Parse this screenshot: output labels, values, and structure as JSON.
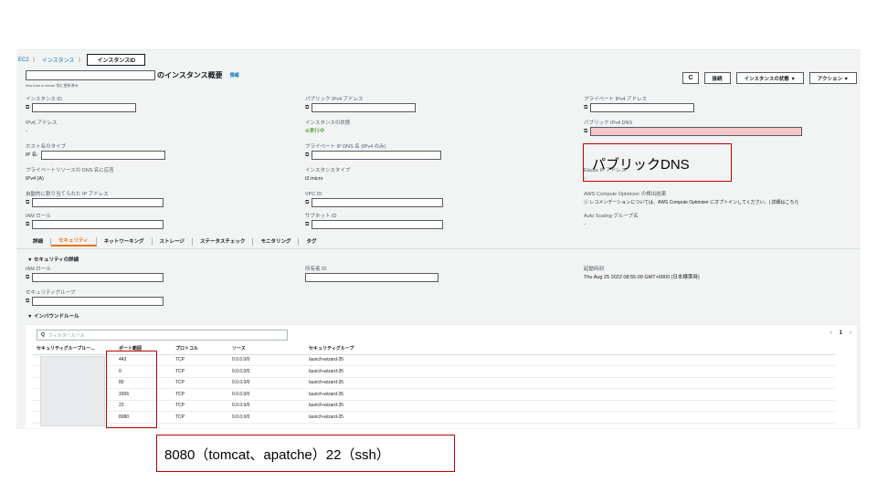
{
  "breadcrumb": {
    "ec2": "EC2",
    "instances": "インスタンス",
    "current": "インスタンスID",
    "sep": "〉"
  },
  "summary": {
    "title_suffix": "のインスタンス概要",
    "info": "情報",
    "updated": "less than a minute 前に更新済み"
  },
  "toolbar": {
    "refresh": "C",
    "connect": "接続",
    "state": "インスタンスの状態 ▼",
    "actions": "アクション ▼"
  },
  "details": {
    "instance_id": "インスタンス ID",
    "public_ipv4": "パブリック IPv4 アドレス",
    "private_ipv4": "プライベート IPv4 アドレス",
    "ipv6": "IPv6 アドレス",
    "ipv6_value": "-",
    "state": "インスタンスの状態",
    "state_value": "⊘実行中",
    "public_dns": "パブリック IPv4 DNS",
    "hostname_type": "ホスト名のタイプ",
    "hostname_prefix": "IP 名:",
    "private_dns_name": "プライベート IP DNS 名 (IPv4 のみ)",
    "answer_dns": "プライベートリソースの DNS 名に応答",
    "answer_dns_value": "IPv4 (A)",
    "instance_type": "インスタンスタイプ",
    "instance_type_value": "t2.micro",
    "elastic_ip": "Elastic IP アドレス",
    "elastic_ip_value": "-",
    "auto_ipv6": "自動的に割り当てられた IP アドレス",
    "vpc_id": "VPC ID",
    "optimizer": "AWS Compute Optimizer の検出結果",
    "optimizer_value": "ⓘ レコメンデーションについては、AWS Compute Optimizer にオプトインしてください。| 詳細はこちら",
    "iam_role": "IAM ロール",
    "subnet_id": "サブネット ID",
    "asg": "Auto Scaling グループ名",
    "asg_value": "-",
    "copy_icon": "⧉"
  },
  "tabs": [
    "詳細",
    "セキュリティ",
    "ネットワーキング",
    "ストレージ",
    "ステータスチェック",
    "モニタリング",
    "タグ"
  ],
  "security": {
    "section": "▼ セキュリティの詳細",
    "iam_role": "IAM ロール",
    "owner": "所有者 ID",
    "launch_time": "起動時刻",
    "launch_time_value": "Thu Aug 25 2022 08:55:09 GMT+0900 (日本標準時)",
    "sg": "セキュリティグループ",
    "inbound": "▼ インバウンドルール"
  },
  "rules": {
    "filter_placeholder": "フィルタールール",
    "search_icon": "Q",
    "pager_prev": "‹",
    "pager_page": "1",
    "pager_next": "›",
    "headers": [
      "セキュリティグループルー...",
      "ポート範囲",
      "プロトコル",
      "ソース",
      "セキュリティグループ"
    ],
    "rows": [
      {
        "port": "443",
        "protocol": "TCP",
        "source": "0.0.0.0/0",
        "sg": "launch-wizard-35"
      },
      {
        "port": "0",
        "protocol": "TCP",
        "source": "0.0.0.0/0",
        "sg": "launch-wizard-35"
      },
      {
        "port": "80",
        "protocol": "TCP",
        "source": "0.0.0.0/0",
        "sg": "launch-wizard-35"
      },
      {
        "port": "3306",
        "protocol": "TCP",
        "source": "0.0.0.0/0",
        "sg": "launch-wizard-35"
      },
      {
        "port": "22",
        "protocol": "TCP",
        "source": "0.0.0.0/0",
        "sg": "launch-wizard-35"
      },
      {
        "port": "8080",
        "protocol": "TCP",
        "source": "0.0.0.0/0",
        "sg": "launch-wizard-35"
      }
    ]
  },
  "annotations": {
    "dns": "パブリックDNS",
    "ports": "8080（tomcat、apatche）22（ssh）"
  },
  "colors": {
    "accent": "#ec7211",
    "link": "#0073bb",
    "annotation": "#c00000",
    "redact_pink": "#f5c6c6"
  }
}
